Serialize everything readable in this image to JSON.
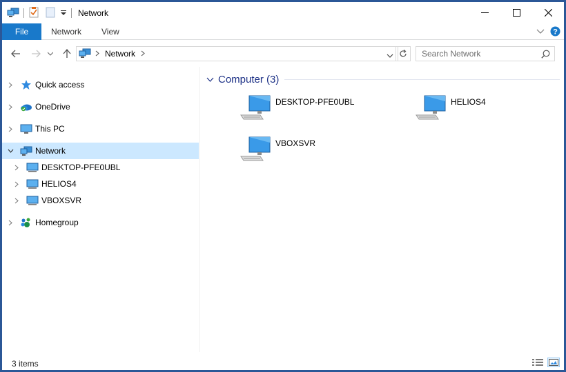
{
  "window": {
    "title": "Network",
    "accent": "#2b5797"
  },
  "ribbon": {
    "tabs": [
      {
        "label": "File",
        "active": true
      },
      {
        "label": "Network"
      },
      {
        "label": "View"
      }
    ]
  },
  "address": {
    "breadcrumb": [
      "Network"
    ],
    "search_placeholder": "Search Network"
  },
  "navpane": {
    "items": [
      {
        "label": "Quick access",
        "icon": "star-icon"
      },
      {
        "label": "OneDrive",
        "icon": "onedrive-icon"
      },
      {
        "label": "This PC",
        "icon": "monitor-icon"
      },
      {
        "label": "Network",
        "icon": "network-icon",
        "selected": true,
        "expanded": true
      },
      {
        "label": "DESKTOP-PFE0UBL",
        "icon": "computer-icon"
      },
      {
        "label": "HELIOS4",
        "icon": "computer-icon"
      },
      {
        "label": "VBOXSVR",
        "icon": "computer-icon"
      },
      {
        "label": "Homegroup",
        "icon": "homegroup-icon"
      }
    ]
  },
  "content": {
    "group_title": "Computer (3)",
    "items": [
      {
        "label": "DESKTOP-PFE0UBL",
        "icon": "computer-icon"
      },
      {
        "label": "HELIOS4",
        "icon": "computer-icon"
      },
      {
        "label": "VBOXSVR",
        "icon": "computer-icon"
      }
    ]
  },
  "status": {
    "count": "3 items"
  }
}
